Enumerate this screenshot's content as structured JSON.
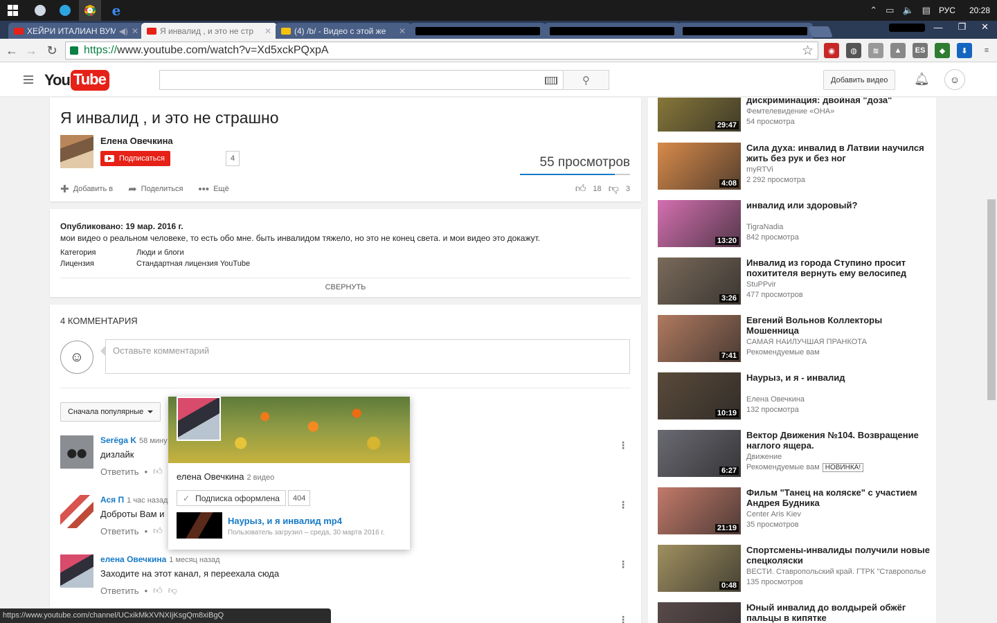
{
  "taskbar": {
    "lang": "РУС",
    "clock": "20:28"
  },
  "browser": {
    "tabs": [
      {
        "title": "ХЕЙРИ ИТАЛИАН ВУМ",
        "icon": "youtube-icon",
        "audio": true
      },
      {
        "title": "Я инвалид , и это не стр",
        "icon": "youtube-icon",
        "active": true
      },
      {
        "title": "(4) /b/ - Видео с этой же",
        "icon": "2ch-icon"
      },
      {
        "title": "",
        "redacted": true
      },
      {
        "title": "",
        "redacted": true
      },
      {
        "title": "",
        "redacted": true
      }
    ],
    "url_https": "https://",
    "url_rest": "www.youtube.com/watch?v=Xd5xckPQxpA",
    "extensions": [
      "adblock",
      "chrome-ext",
      "stack",
      "vpn",
      "ES",
      "2gis",
      "download"
    ]
  },
  "yt_header": {
    "logo_you": "You",
    "logo_tube": "Tube",
    "search_placeholder": "",
    "upload_label": "Добавить видео"
  },
  "video": {
    "title": "Я инвалид , и это не страшно",
    "channel": "Елена Овечкина",
    "subscribe_label": "Подписаться",
    "subscriber_count": "4",
    "views": "55 просмотров",
    "like_ratio": 0.86,
    "actions": {
      "add": "Добавить в",
      "share": "Поделиться",
      "more": "Ещё"
    },
    "likes": "18",
    "dislikes": "3"
  },
  "description": {
    "published": "Опубликовано: 19 мар. 2016 г.",
    "text": "мои видео о реальном человеке, то есть обо мне. быть инвалидом тяжело, но это не конец света. и мои видео это докажут.",
    "category_label": "Категория",
    "category_value": "Люди и блоги",
    "license_label": "Лицензия",
    "license_value": "Стандартная лицензия YouTube",
    "collapse_label": "СВЕРНУТЬ"
  },
  "comments": {
    "heading": "4 КОММЕНТАРИЯ",
    "placeholder": "Оставьте комментарий",
    "sort_label": "Сначала популярные",
    "reply_label": "Ответить",
    "items": [
      {
        "author": "Serёga K",
        "time": "58 мину",
        "text": "дизлайк"
      },
      {
        "author": "Ася П",
        "time": "1 час назад",
        "text": "Доброты Вам и"
      },
      {
        "author": "елена Овечкина",
        "time": "1 месяц назад",
        "text": "Заходите на этот канал, я переехала сюда"
      }
    ]
  },
  "hovercard": {
    "name": "елена Овечкина",
    "video_count": "2 видео",
    "subscribed_label": "Подписка оформлена",
    "subscriber_count": "404",
    "video_title": "Наурыз, и я инвалид mp4",
    "video_meta": "Пользователь загрузил – среда, 30 марта 2016 г."
  },
  "sidebar": {
    "items": [
      {
        "title": "дискриминация: двойная \"доза\"",
        "channel": "Фемтелевидение «ОНА»",
        "views": "54 просмотра",
        "duration": "29:47",
        "thumb": "#8a7a3a"
      },
      {
        "title": "Сила духа: инвалид в Латвии научился жить без рук и без ног",
        "channel": "myRTVi",
        "views": "2 292 просмотра",
        "duration": "4:08",
        "thumb": "#d88a4a"
      },
      {
        "title": "инвалид или здоровый?",
        "channel": "TigraNadia",
        "views": "842 просмотра",
        "duration": "13:20",
        "thumb": "#d46fb0"
      },
      {
        "title": "Инвалид из города Ступино просит похитителя вернуть ему велосипед",
        "channel": "StuPPvir",
        "views": "477 просмотров",
        "duration": "3:26",
        "thumb": "#7a6a5a"
      },
      {
        "title": "Евгений Вольнов Коллекторы Мошенница",
        "channel": "САМАЯ НАИЛУЧШАЯ ПРАНКОТА",
        "views": "Рекомендуемые вам",
        "duration": "7:41",
        "thumb": "#b07a60"
      },
      {
        "title": "Наурыз, и я - инвалид",
        "channel": "Елена Овечкина",
        "views": "132 просмотра",
        "duration": "10:19",
        "thumb": "#5a4a3a"
      },
      {
        "title": "Вектор Движения №104. Возвращение наглого ящера.",
        "channel": "Движение",
        "views": "Рекомендуемые вам",
        "badge": "НОВИНКА!",
        "duration": "6:27",
        "thumb": "#6a6a72"
      },
      {
        "title": "Фильм \"Танец на коляске\" с участием Андрея Будника",
        "channel": "Center Aris Kiev",
        "views": "35 просмотров",
        "duration": "21:19",
        "thumb": "#c27a6a"
      },
      {
        "title": "Спортсмены-инвалиды получили новые спецколяски",
        "channel": "ВЕСТИ. Ставропольский край. ГТРК \"Ставрополье",
        "views": "135 просмотров",
        "duration": "0:48",
        "thumb": "#a09060"
      },
      {
        "title": "Юный инвалид до волдырей обжёг пальцы в кипятке",
        "channel": "",
        "views": "",
        "duration": "",
        "thumb": "#5a4a4a"
      }
    ]
  },
  "status_url": "https://www.youtube.com/channel/UCxikMkXVNXIjKsgQm8xiBgQ"
}
